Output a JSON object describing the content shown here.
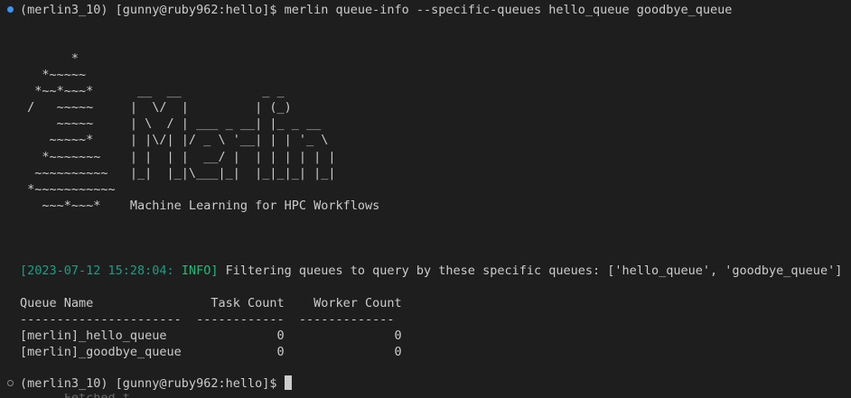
{
  "terminal": {
    "command_line": {
      "prompt": "(merlin3_10) [gunny@ruby962:hello]$ ",
      "command": "merlin queue-info --specific-queues hello_queue goodbye_queue"
    },
    "banner_ascii": "       *\n   *~~~~~\n  *~~*~~~*      __  __           _ _\n /   ~~~~~     |  \\/  |         | (_)\n     ~~~~~     | \\  / | ___ _ __| |_ _ __\n    ~~~~~*     | |\\/| |/ _ \\ '__| | | '_ \\\n   *~~~~~~~    | |  | |  __/ |  | | | | | |\n  ~~~~~~~~~~   |_|  |_|\\___|_|  |_|_|_| |_|\n *~~~~~~~~~~~\n   ~~~*~~~*    Machine Learning for HPC Workflows",
    "log_line": {
      "timestamp": "[2023-07-12 15:28:04:",
      "level": " INFO]",
      "message": " Filtering queues to query by these specific queues: ['hello_queue', 'goodbye_queue']"
    },
    "table": {
      "header": "Queue Name                Task Count    Worker Count",
      "separator": "----------------------  ------------  -------------",
      "rows": [
        "[merlin]_hello_queue               0               0",
        "[merlin]_goodbye_queue             0               0"
      ]
    },
    "final_prompt": "(merlin3_10) [gunny@ruby962:hello]$ ",
    "cut_off_text": "      Fetched t"
  }
}
